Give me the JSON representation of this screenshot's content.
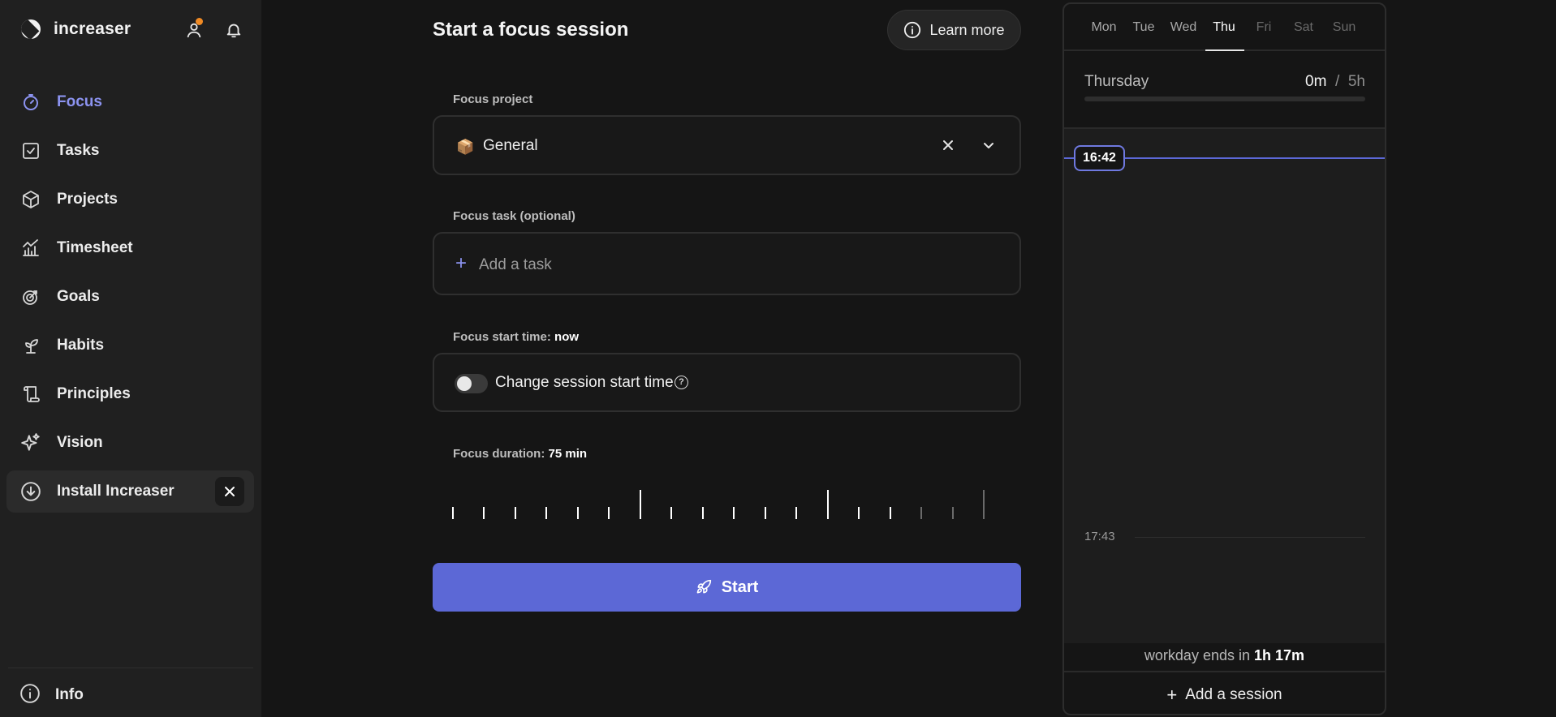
{
  "app": {
    "name": "increaser"
  },
  "nav": {
    "items": [
      {
        "label": "Focus",
        "icon": "focus-timer-icon"
      },
      {
        "label": "Tasks",
        "icon": "tasks-checkbox-icon"
      },
      {
        "label": "Projects",
        "icon": "projects-cube-icon"
      },
      {
        "label": "Timesheet",
        "icon": "timesheet-chart-icon"
      },
      {
        "label": "Goals",
        "icon": "goals-target-icon"
      },
      {
        "label": "Habits",
        "icon": "habits-sprout-icon"
      },
      {
        "label": "Principles",
        "icon": "principles-scroll-icon"
      },
      {
        "label": "Vision",
        "icon": "vision-sparkles-icon"
      },
      {
        "label": "Install Increaser",
        "icon": "install-download-icon"
      }
    ],
    "active": "Focus",
    "info_label": "Info"
  },
  "main": {
    "title": "Start a focus session",
    "learn_more": "Learn more",
    "project_label": "Focus project",
    "project_value": "General",
    "project_emoji": "📦",
    "task_label": "Focus task (optional)",
    "task_placeholder": "Add a task",
    "start_time_label": "Focus start time:",
    "start_time_value": "now",
    "start_time_toggle_label": "Change session start time",
    "start_time_toggle_on": false,
    "duration_label": "Focus duration:",
    "duration_value": "75 min",
    "start_button": "Start"
  },
  "schedule": {
    "days": [
      "Mon",
      "Tue",
      "Wed",
      "Thu",
      "Fri",
      "Sat",
      "Sun"
    ],
    "selected_day": "Thu",
    "day_name": "Thursday",
    "worked": "0m",
    "separator": "/",
    "goal": "5h",
    "progress": 0,
    "now_time": "16:42",
    "hour_mark": "17:43",
    "workday_prefix": "workday ends in",
    "workday_remaining": "1h 17m",
    "add_session": "Add a session"
  },
  "colors": {
    "accent": "#5c68d6",
    "accent_text": "#8c93f0",
    "notification": "#f08a24",
    "background": "#151515",
    "sidebar": "#202020"
  }
}
